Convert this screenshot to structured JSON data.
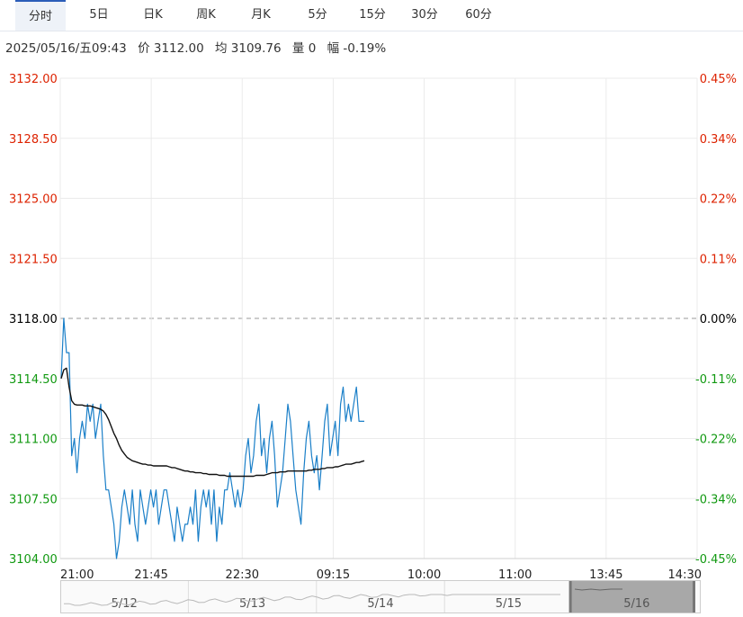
{
  "tabs": [
    {
      "label": "分时",
      "active": true
    },
    {
      "label": "5日",
      "active": false
    },
    {
      "label": "日K",
      "active": false
    },
    {
      "label": "周K",
      "active": false
    },
    {
      "label": "月K",
      "active": false
    },
    {
      "label": "5分",
      "active": false
    },
    {
      "label": "15分",
      "active": false
    },
    {
      "label": "30分",
      "active": false
    },
    {
      "label": "60分",
      "active": false
    }
  ],
  "info": {
    "datetime": "2025/05/16/五09:43",
    "price": "价 3112.00",
    "avg": "均 3109.76",
    "volume": "量 0",
    "change": "幅 -0.19%"
  },
  "colors": {
    "up": "#dd2200",
    "down": "#119911",
    "base": "#000000",
    "price_line": "#1a7fc8",
    "avg_line": "#111111",
    "grid": "#ebebeb",
    "tab_accent": "#2b5db8"
  },
  "chart_data": {
    "type": "line",
    "base_price": 3118.0,
    "ylim": [
      3104.0,
      3132.0
    ],
    "y_ticks": [
      "3132.00",
      "3128.50",
      "3125.00",
      "3121.50",
      "3118.00",
      "3114.50",
      "3111.00",
      "3107.50",
      "3104.00"
    ],
    "pct_ticks": [
      "0.45%",
      "0.34%",
      "0.22%",
      "0.11%",
      "0.00%",
      "-0.11%",
      "-0.22%",
      "-0.34%",
      "-0.45%"
    ],
    "x_ticks": [
      "21:00",
      "21:45",
      "22:30",
      "09:15",
      "10:00",
      "11:00",
      "13:45",
      "14:30"
    ],
    "total_minutes": 690,
    "series": [
      {
        "values": [
          3114.5,
          3118,
          3116,
          3116,
          3110,
          3111,
          3109,
          3111,
          3112,
          3111,
          3113,
          3112,
          3113,
          3111,
          3112,
          3113,
          3110,
          3108,
          3108,
          3107,
          3106,
          3104,
          3105,
          3107,
          3108,
          3107,
          3106,
          3108,
          3106,
          3105,
          3108,
          3107,
          3106,
          3107,
          3108,
          3107,
          3108,
          3106,
          3107,
          3108,
          3108,
          3107,
          3106,
          3105,
          3107,
          3106,
          3105,
          3106,
          3106,
          3107,
          3106,
          3108,
          3105,
          3107,
          3108,
          3107,
          3108,
          3106,
          3108,
          3105,
          3107,
          3106,
          3108,
          3108,
          3109,
          3108,
          3107,
          3108,
          3107,
          3108,
          3110,
          3111,
          3109,
          3110,
          3112,
          3113,
          3110,
          3111,
          3109,
          3111,
          3112,
          3110,
          3107,
          3108,
          3109,
          3111,
          3113,
          3112,
          3110,
          3108,
          3107,
          3106,
          3109,
          3111,
          3112,
          3110,
          3109,
          3110,
          3108,
          3110,
          3112,
          3113,
          3110,
          3111,
          3112,
          3110,
          3113,
          3114,
          3112,
          3113,
          3112,
          3113,
          3114,
          3112,
          3112,
          3112
        ]
      },
      {
        "values": [
          3114.5,
          3115,
          3115.1,
          3114,
          3113.2,
          3113,
          3112.95,
          3112.95,
          3112.95,
          3112.9,
          3112.9,
          3112.9,
          3112.85,
          3112.8,
          3112.75,
          3112.7,
          3112.6,
          3112.4,
          3112.1,
          3111.7,
          3111.3,
          3111,
          3110.6,
          3110.3,
          3110.1,
          3109.9,
          3109.8,
          3109.7,
          3109.65,
          3109.6,
          3109.55,
          3109.5,
          3109.5,
          3109.45,
          3109.45,
          3109.4,
          3109.4,
          3109.4,
          3109.4,
          3109.4,
          3109.4,
          3109.35,
          3109.3,
          3109.3,
          3109.25,
          3109.2,
          3109.15,
          3109.1,
          3109.1,
          3109.05,
          3109.05,
          3109,
          3109,
          3109,
          3108.95,
          3108.95,
          3108.9,
          3108.9,
          3108.9,
          3108.9,
          3108.85,
          3108.85,
          3108.85,
          3108.8,
          3108.8,
          3108.8,
          3108.8,
          3108.8,
          3108.8,
          3108.8,
          3108.8,
          3108.8,
          3108.8,
          3108.8,
          3108.85,
          3108.85,
          3108.85,
          3108.85,
          3108.9,
          3108.95,
          3109,
          3109,
          3109,
          3109.05,
          3109.05,
          3109.05,
          3109.1,
          3109.1,
          3109.1,
          3109.1,
          3109.1,
          3109.1,
          3109.1,
          3109.1,
          3109.15,
          3109.15,
          3109.2,
          3109.2,
          3109.2,
          3109.25,
          3109.25,
          3109.3,
          3109.3,
          3109.3,
          3109.35,
          3109.35,
          3109.4,
          3109.45,
          3109.5,
          3109.5,
          3109.5,
          3109.55,
          3109.6,
          3109.6,
          3109.65,
          3109.7
        ]
      }
    ]
  },
  "navigator": {
    "labels": [
      "5/12",
      "5/13",
      "5/14",
      "5/15",
      "5/16"
    ],
    "selected_index": 4
  }
}
